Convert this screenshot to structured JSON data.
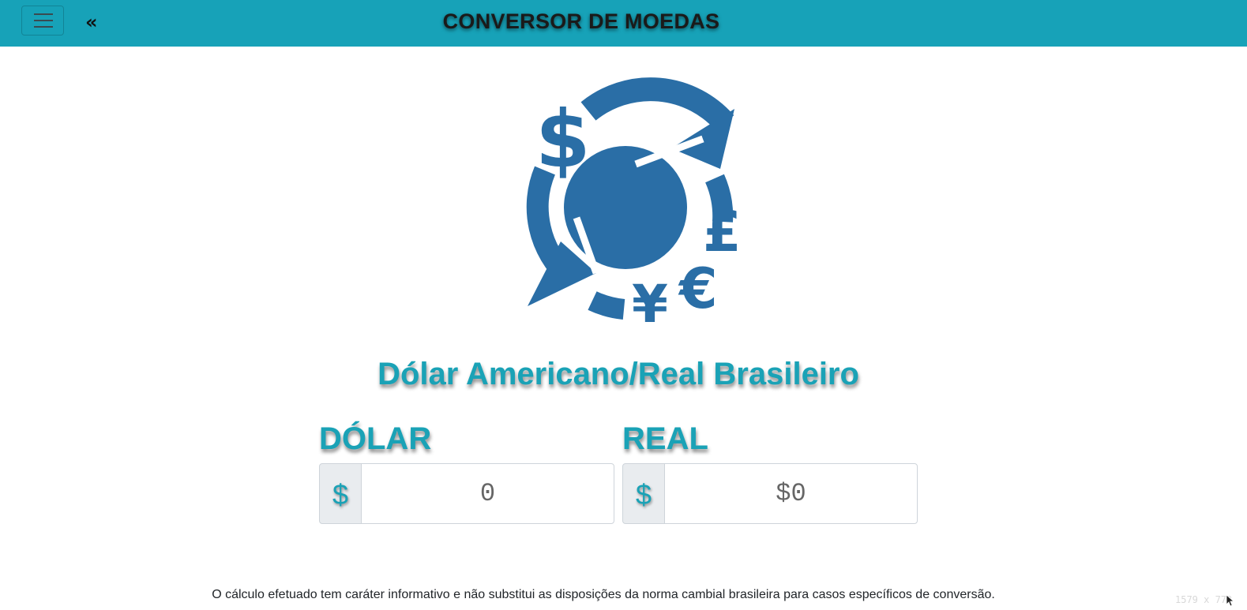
{
  "navbar": {
    "toggle_icon": "hamburger-menu-icon",
    "collapse_icon": "double-chevron-left-icon",
    "collapse_glyph": "«",
    "title": "CONVERSOR DE MOEDAS",
    "color": "#17a2b8"
  },
  "logo": {
    "icon": "currency-exchange-icon",
    "color": "#2a6ea6",
    "symbols": [
      "$",
      "£",
      "€",
      "¥"
    ]
  },
  "main": {
    "pair_title": "Dólar Americano/Real Brasileiro",
    "accent_color": "#1aa2b6",
    "converters": [
      {
        "label": "DÓLAR",
        "prefix": "$",
        "value": "0"
      },
      {
        "label": "REAL",
        "prefix": "$",
        "value": "$0"
      }
    ]
  },
  "footer": {
    "disclaimer": "O cálculo efetuado tem caráter informativo e não substitui as disposições da norma cambial brasileira para casos específicos de conversão."
  },
  "overlay": {
    "dimensions_text": "1579 x 773"
  }
}
